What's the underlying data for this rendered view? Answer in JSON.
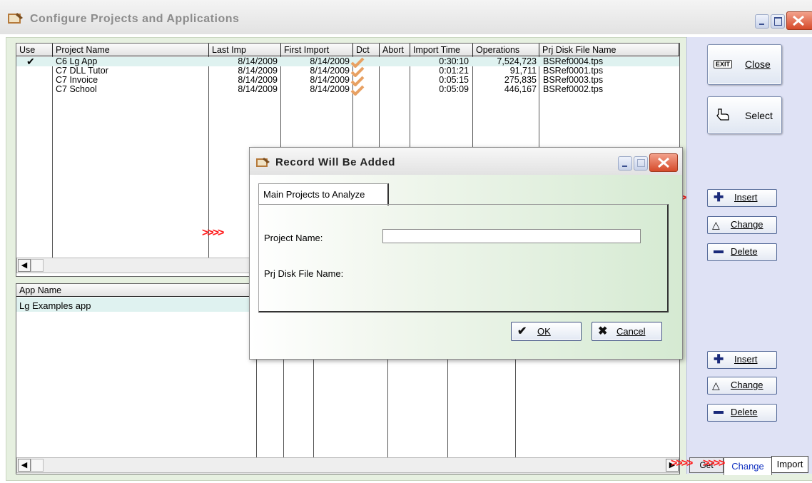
{
  "window": {
    "title": "Configure Projects and Applications"
  },
  "projects_grid": {
    "headers": [
      "Use",
      "Project Name",
      "Last Imp",
      "First Import",
      "Dct",
      "Abort",
      "Import Time",
      "Operations",
      "Prj Disk File Name"
    ],
    "rows": [
      {
        "use": "✔",
        "name": "C6 Lg App",
        "last": "8/14/2009",
        "first": "8/14/2009",
        "time": "0:30:10",
        "ops": "7,524,723",
        "file": "BSRef0004.tps"
      },
      {
        "use": "",
        "name": "C7 DLL Tutor",
        "last": "8/14/2009",
        "first": "8/14/2009",
        "time": "0:01:21",
        "ops": "91,711",
        "file": "BSRef0001.tps"
      },
      {
        "use": "",
        "name": "C7 Invoice",
        "last": "8/14/2009",
        "first": "8/14/2009",
        "time": "0:05:15",
        "ops": "275,835",
        "file": "BSRef0003.tps"
      },
      {
        "use": "",
        "name": "C7 School",
        "last": "8/14/2009",
        "first": "8/14/2009",
        "time": "0:05:09",
        "ops": "446,167",
        "file": "BSRef0002.tps"
      }
    ]
  },
  "apps_grid": {
    "header": "App Name",
    "rows": [
      "Lg Examples app"
    ]
  },
  "right_panel": {
    "close_label": "Close",
    "close_badge": "EXIT",
    "select_label": "Select",
    "insert1": "Insert",
    "change1": "Change",
    "delete1": "Delete",
    "insert2": "Insert",
    "change2": "Change",
    "delete2": "Delete"
  },
  "bottom_tabs": {
    "get": "Get",
    "change": "Change",
    "import": "Import"
  },
  "dialog": {
    "title": "Record Will Be Added",
    "tab": "Main Projects to Analyze",
    "project_name_label": "Project Name:",
    "project_name_value": "",
    "disk_file_label": "Prj Disk File Name:",
    "ok_label": "OK",
    "cancel_label": "Cancel"
  },
  "annotations": {
    "arrow": ">>>>"
  },
  "colors": {
    "check": "#e8a163",
    "selected_row": "#dff2f0",
    "arrow_red": "#ff1a1a",
    "right_panel": "#dfe2f5"
  }
}
